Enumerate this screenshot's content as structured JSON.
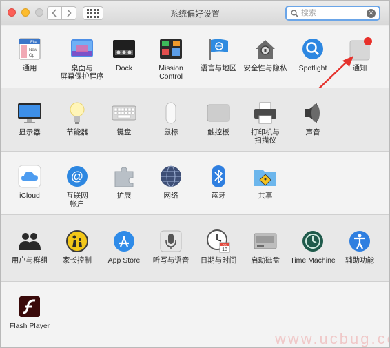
{
  "window": {
    "title": "系统偏好设置"
  },
  "search": {
    "placeholder": "搜索"
  },
  "panes": {
    "general": "通用",
    "desktop": "桌面与\n屏幕保护程序",
    "dock": "Dock",
    "mission_control": "Mission\nControl",
    "language_region": "语言与地区",
    "security": "安全性与隐私",
    "spotlight": "Spotlight",
    "notifications": "通知",
    "displays": "显示器",
    "energy_saver": "节能器",
    "keyboard": "键盘",
    "mouse": "鼠标",
    "trackpad": "触控板",
    "printers": "打印机与\n扫描仪",
    "sound": "声音",
    "icloud": "iCloud",
    "internet_accounts": "互联网\n帐户",
    "extensions": "扩展",
    "network": "网络",
    "bluetooth": "蓝牙",
    "sharing": "共享",
    "users_groups": "用户与群组",
    "parental_controls": "家长控制",
    "app_store": "App Store",
    "dictation": "听写与语音",
    "date_time": "日期与时间",
    "startup_disk": "启动磁盘",
    "time_machine": "Time Machine",
    "accessibility": "辅助功能",
    "flash_player": "Flash Player"
  },
  "icon_text": {
    "general_file": "File",
    "general_new": "New",
    "general_op": "Op",
    "calendar_month": "JUL",
    "calendar_day": "18"
  },
  "watermark": "www.ucbug.cc",
  "colors": {
    "accent_blue": "#2f7fe0",
    "arrow_red": "#e5322d",
    "badge_red": "#e8302a"
  }
}
